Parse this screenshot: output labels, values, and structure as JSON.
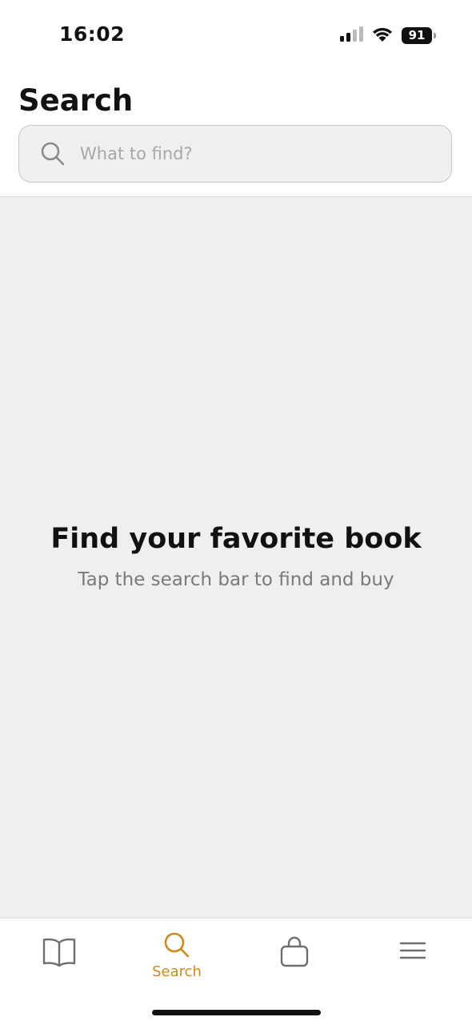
{
  "status_bar": {
    "time": "16:02",
    "battery": "91",
    "icons": [
      "cellular-signal-icon",
      "wifi-icon",
      "battery-icon"
    ]
  },
  "header": {
    "title": "Search"
  },
  "search": {
    "placeholder": "What to find?",
    "value": "",
    "icon": "search-icon"
  },
  "empty_state": {
    "title": "Find your favorite book",
    "subtitle": "Tap the search bar to find and buy"
  },
  "tab_bar": {
    "active_color": "#d08a1a",
    "inactive_color": "#6e6e6e",
    "tabs": [
      {
        "icon": "open-book-icon",
        "label": "",
        "active": false
      },
      {
        "icon": "search-icon",
        "label": "Search",
        "active": true
      },
      {
        "icon": "shopping-bag-icon",
        "label": "",
        "active": false
      },
      {
        "icon": "menu-icon",
        "label": "",
        "active": false
      }
    ]
  },
  "colors": {
    "accent": "#d08a1a",
    "background": "#efefef"
  }
}
